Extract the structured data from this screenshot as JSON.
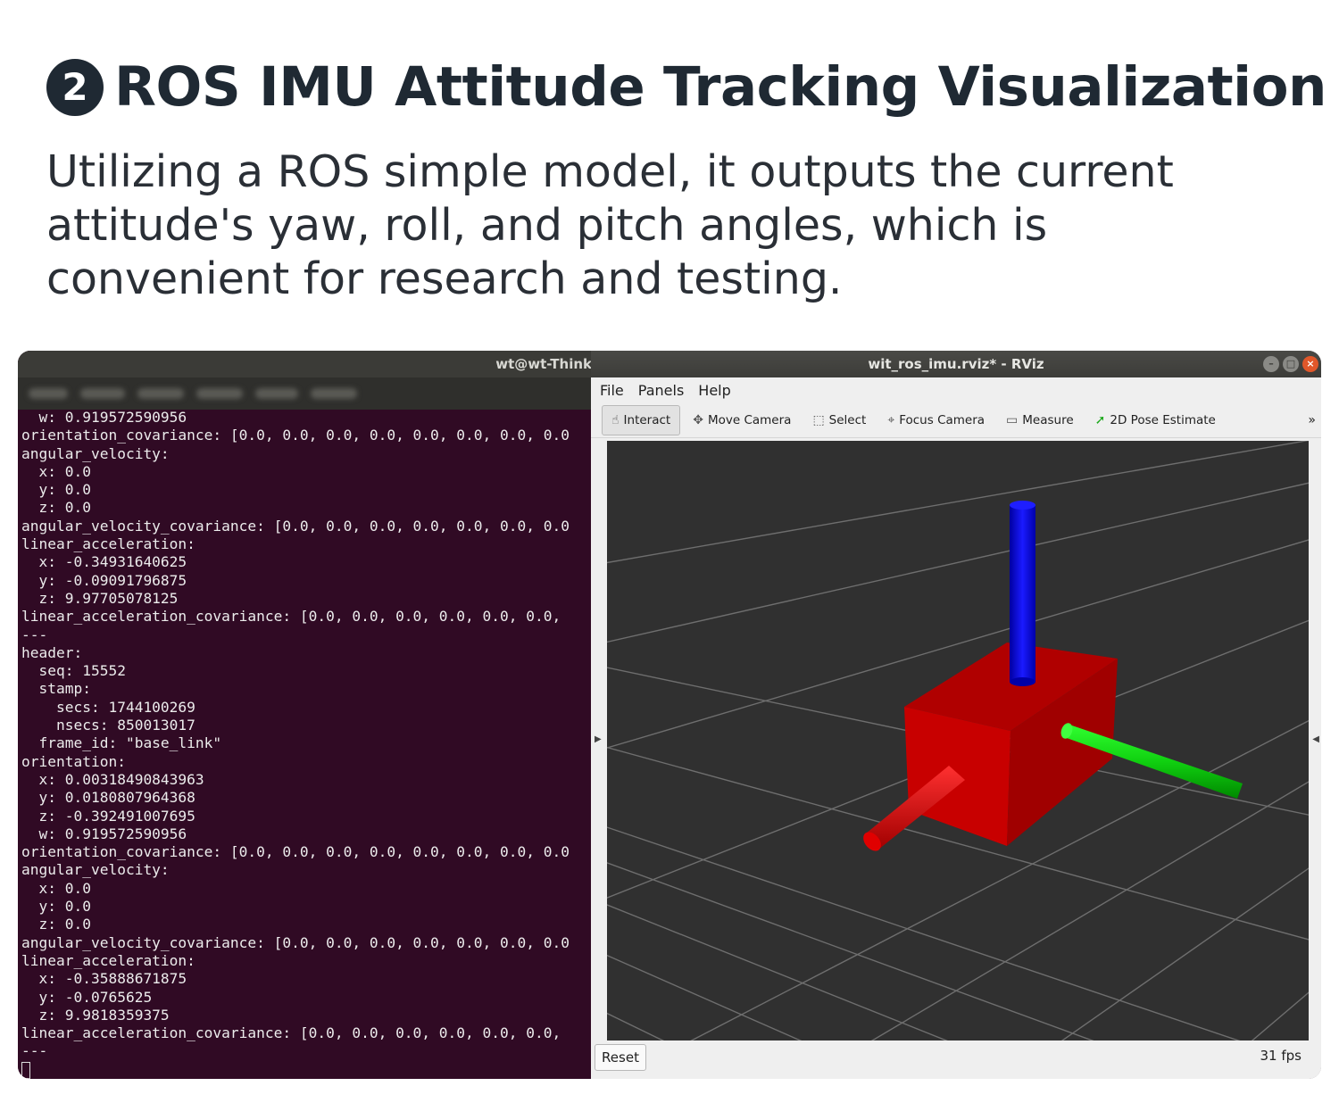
{
  "heading": {
    "step_number": "2",
    "title": "ROS IMU Attitude Tracking Visualization",
    "subtitle_lines": [
      "Utilizing a ROS simple model, it outputs the current",
      "attitude's yaw, roll, and pitch angles, which is",
      "convenient for research and testing."
    ]
  },
  "terminal": {
    "title": "wt@wt-ThinkP",
    "lines": [
      "  w: 0.919572590956",
      "orientation_covariance: [0.0, 0.0, 0.0, 0.0, 0.0, 0.0, 0.0, 0.0",
      "angular_velocity:",
      "  x: 0.0",
      "  y: 0.0",
      "  z: 0.0",
      "angular_velocity_covariance: [0.0, 0.0, 0.0, 0.0, 0.0, 0.0, 0.0",
      "linear_acceleration:",
      "  x: -0.34931640625",
      "  y: -0.09091796875",
      "  z: 9.97705078125",
      "linear_acceleration_covariance: [0.0, 0.0, 0.0, 0.0, 0.0, 0.0,",
      "---",
      "header:",
      "  seq: 15552",
      "  stamp:",
      "    secs: 1744100269",
      "    nsecs: 850013017",
      "  frame_id: \"base_link\"",
      "orientation:",
      "  x: 0.00318490843963",
      "  y: 0.0180807964368",
      "  z: -0.392491007695",
      "  w: 0.919572590956",
      "orientation_covariance: [0.0, 0.0, 0.0, 0.0, 0.0, 0.0, 0.0, 0.0",
      "angular_velocity:",
      "  x: 0.0",
      "  y: 0.0",
      "  z: 0.0",
      "angular_velocity_covariance: [0.0, 0.0, 0.0, 0.0, 0.0, 0.0, 0.0",
      "linear_acceleration:",
      "  x: -0.35888671875",
      "  y: -0.0765625",
      "  z: 9.9818359375",
      "linear_acceleration_covariance: [0.0, 0.0, 0.0, 0.0, 0.0, 0.0,",
      "---"
    ]
  },
  "rviz": {
    "title": "wit_ros_imu.rviz* - RViz",
    "menu": [
      "File",
      "Panels",
      "Help"
    ],
    "toolbar": [
      {
        "label": "Interact",
        "icon": "hand-icon",
        "glyph": "☝",
        "active": true
      },
      {
        "label": "Move Camera",
        "icon": "move-camera-icon",
        "glyph": "✥",
        "active": false
      },
      {
        "label": "Select",
        "icon": "select-icon",
        "glyph": "⬚",
        "active": false
      },
      {
        "label": "Focus Camera",
        "icon": "focus-camera-icon",
        "glyph": "⌖",
        "active": false
      },
      {
        "label": "Measure",
        "icon": "ruler-icon",
        "glyph": "▭",
        "active": false
      },
      {
        "label": "2D Pose Estimate",
        "icon": "pose-arrow-icon",
        "glyph": "➚",
        "active": false
      }
    ],
    "toolbar_more": "»",
    "reset_label": "Reset",
    "fps": "31 fps",
    "colors": {
      "viewport_bg": "#303030",
      "grid": "#6e6e6e",
      "box": "#c00000",
      "x_axis": "#d40000",
      "y_axis": "#00c800",
      "z_axis": "#0000e0"
    }
  }
}
